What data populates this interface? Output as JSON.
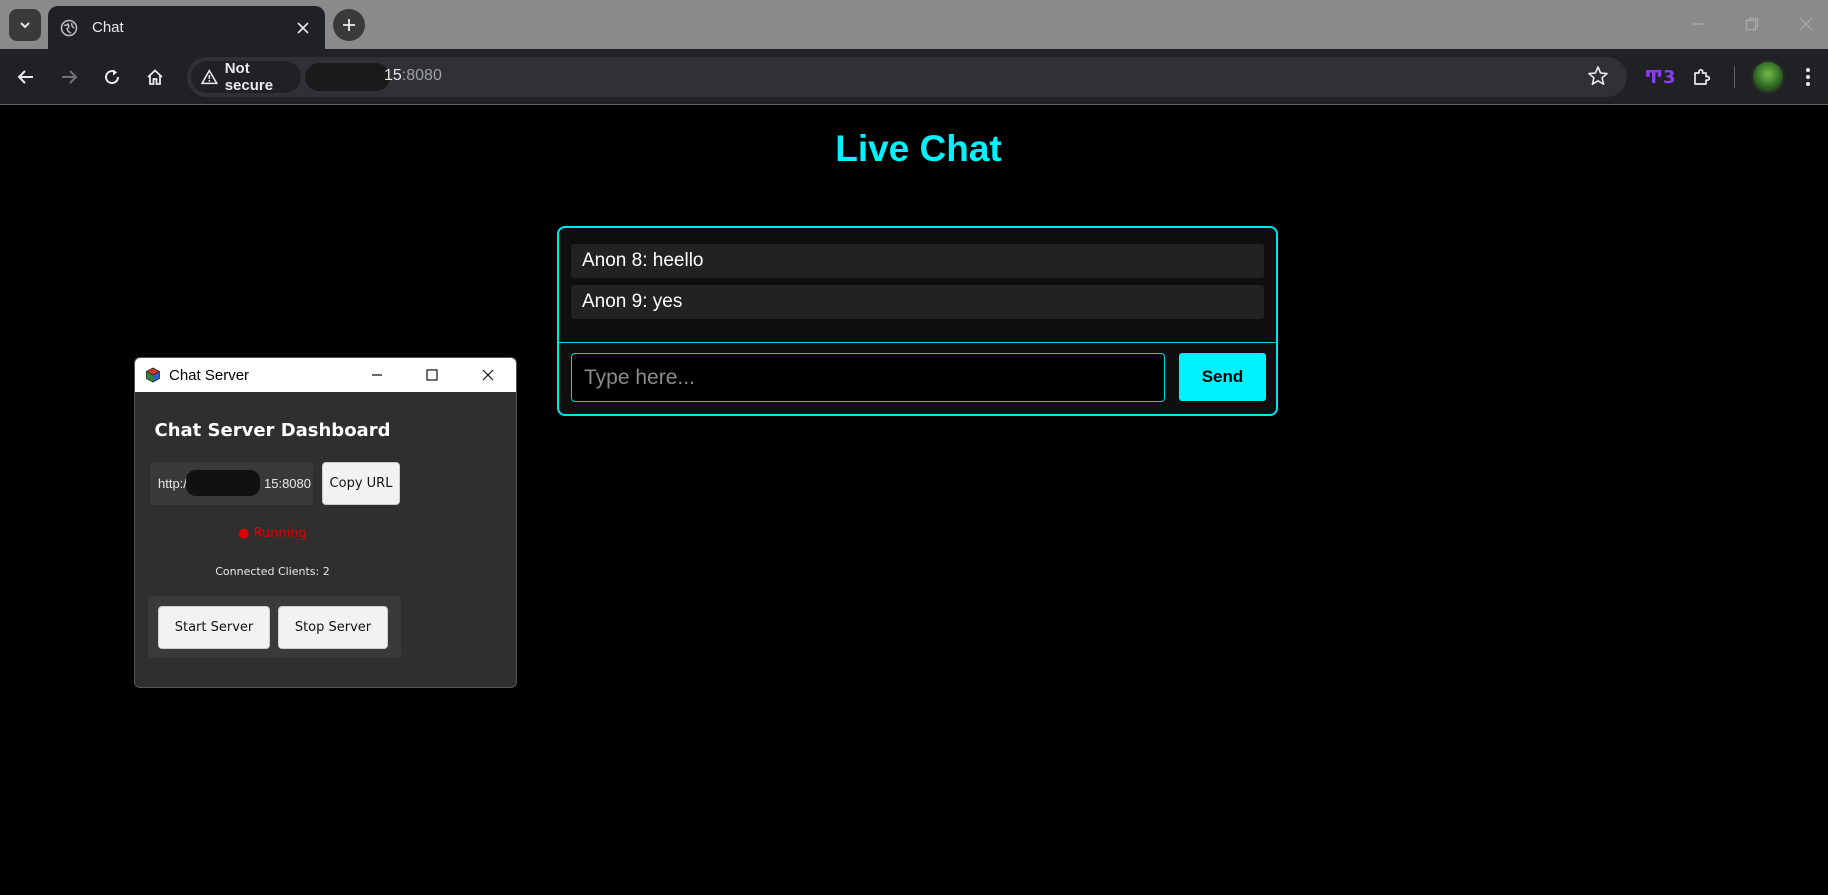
{
  "browser": {
    "tab_title": "Chat",
    "security_label": "Not secure",
    "url_host": "15",
    "url_port": ":8080"
  },
  "page": {
    "title": "Live Chat",
    "messages": [
      "Anon 8: heello",
      "Anon 9: yes"
    ],
    "input_placeholder": "Type here...",
    "send_label": "Send"
  },
  "app": {
    "window_title": "Chat Server",
    "dashboard_title": "Chat Server Dashboard",
    "url_prefix": "http:/",
    "url_suffix": "15:8080",
    "copy_label": "Copy URL",
    "status_text": "● Running",
    "clients_text": "Connected Clients: 2",
    "start_label": "Start Server",
    "stop_label": "Stop Server"
  },
  "colors": {
    "accent": "#00f2ff",
    "status_running": "#e00000"
  }
}
